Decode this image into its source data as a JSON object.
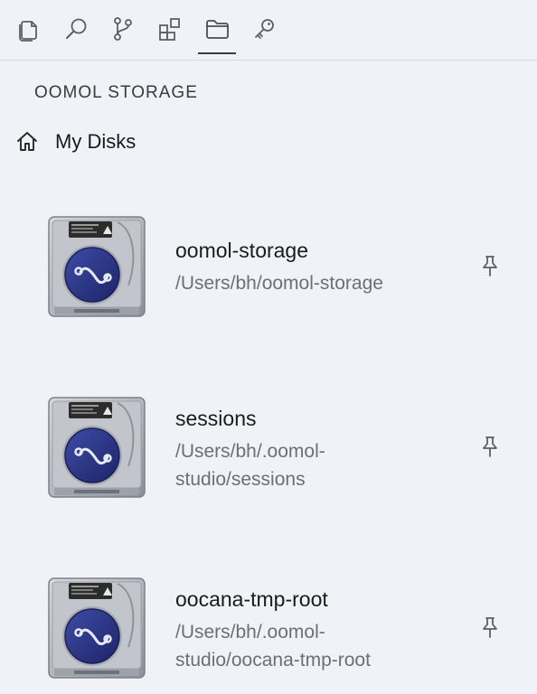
{
  "toolbar": {
    "items": [
      {
        "name": "explorer",
        "icon": "files-icon"
      },
      {
        "name": "search",
        "icon": "search-icon"
      },
      {
        "name": "source-control",
        "icon": "source-control-icon"
      },
      {
        "name": "extensions",
        "icon": "extensions-icon"
      },
      {
        "name": "storage",
        "icon": "folder-icon",
        "active": true
      },
      {
        "name": "secrets",
        "icon": "key-icon"
      }
    ]
  },
  "section": {
    "title": "OOMOL STORAGE"
  },
  "breadcrumb": {
    "icon": "home-icon",
    "label": "My Disks"
  },
  "disks": [
    {
      "name": "oomol-storage",
      "path_lines": [
        "/Users/bh/oomol-storage"
      ],
      "icon": "hard-drive-icon",
      "pin_icon": "pin-icon"
    },
    {
      "name": "sessions",
      "path_lines": [
        "/Users/bh/.oomol-",
        "studio/sessions"
      ],
      "icon": "hard-drive-icon",
      "pin_icon": "pin-icon"
    },
    {
      "name": "oocana-tmp-root",
      "path_lines": [
        "/Users/bh/.oomol-",
        "studio/oocana-tmp-root"
      ],
      "icon": "hard-drive-icon",
      "pin_icon": "pin-icon"
    }
  ],
  "colors": {
    "background": "#f1f2f7",
    "icon_stroke": "#5b5f69",
    "active_indicator": "#3c3c3c",
    "path_text": "#6b6f79",
    "drive_platter": "#2c3a8c"
  }
}
